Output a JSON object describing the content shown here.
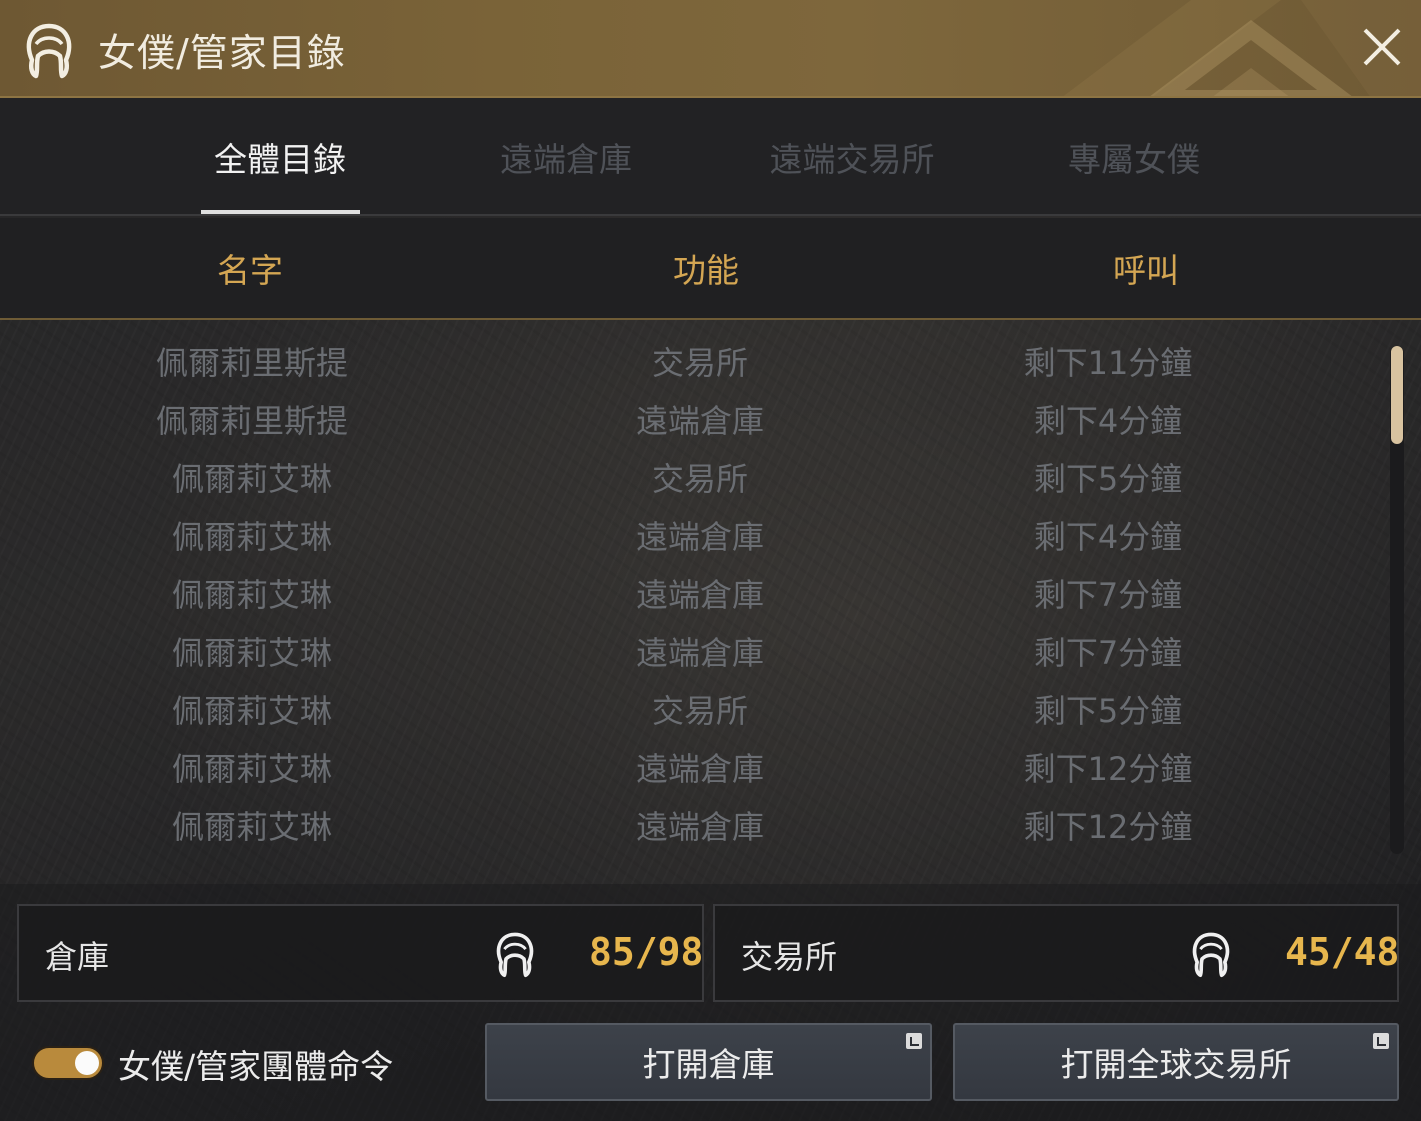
{
  "window": {
    "title": "女僕/管家目錄",
    "title_icon": "maid-icon",
    "close_icon": "close-icon"
  },
  "tabs": [
    {
      "label": "全體目錄",
      "active": true
    },
    {
      "label": "遠端倉庫",
      "active": false
    },
    {
      "label": "遠端交易所",
      "active": false
    },
    {
      "label": "專屬女僕",
      "active": false
    }
  ],
  "table": {
    "headers": {
      "name": "名字",
      "function": "功能",
      "call": "呼叫"
    },
    "rows": [
      {
        "name": "佩爾莉里斯提",
        "function": "交易所",
        "call": "剩下11分鐘"
      },
      {
        "name": "佩爾莉里斯提",
        "function": "遠端倉庫",
        "call": "剩下4分鐘"
      },
      {
        "name": "佩爾莉艾琳",
        "function": "交易所",
        "call": "剩下5分鐘"
      },
      {
        "name": "佩爾莉艾琳",
        "function": "遠端倉庫",
        "call": "剩下4分鐘"
      },
      {
        "name": "佩爾莉艾琳",
        "function": "遠端倉庫",
        "call": "剩下7分鐘"
      },
      {
        "name": "佩爾莉艾琳",
        "function": "遠端倉庫",
        "call": "剩下7分鐘"
      },
      {
        "name": "佩爾莉艾琳",
        "function": "交易所",
        "call": "剩下5分鐘"
      },
      {
        "name": "佩爾莉艾琳",
        "function": "遠端倉庫",
        "call": "剩下12分鐘"
      },
      {
        "name": "佩爾莉艾琳",
        "function": "遠端倉庫",
        "call": "剩下12分鐘"
      }
    ]
  },
  "counts": {
    "warehouse": {
      "label": "倉庫",
      "value": "85/98",
      "icon": "maid-icon"
    },
    "market": {
      "label": "交易所",
      "value": "45/48",
      "icon": "maid-icon"
    }
  },
  "footer": {
    "toggle_label": "女僕/管家團體命令",
    "toggle_on": true,
    "open_warehouse": "打開倉庫",
    "open_market": "打開全球交易所"
  },
  "colors": {
    "title_bar": "#7a6338",
    "header_text": "#d4a653",
    "count_value": "#e7b64d",
    "toggle": "#b98a3c"
  }
}
